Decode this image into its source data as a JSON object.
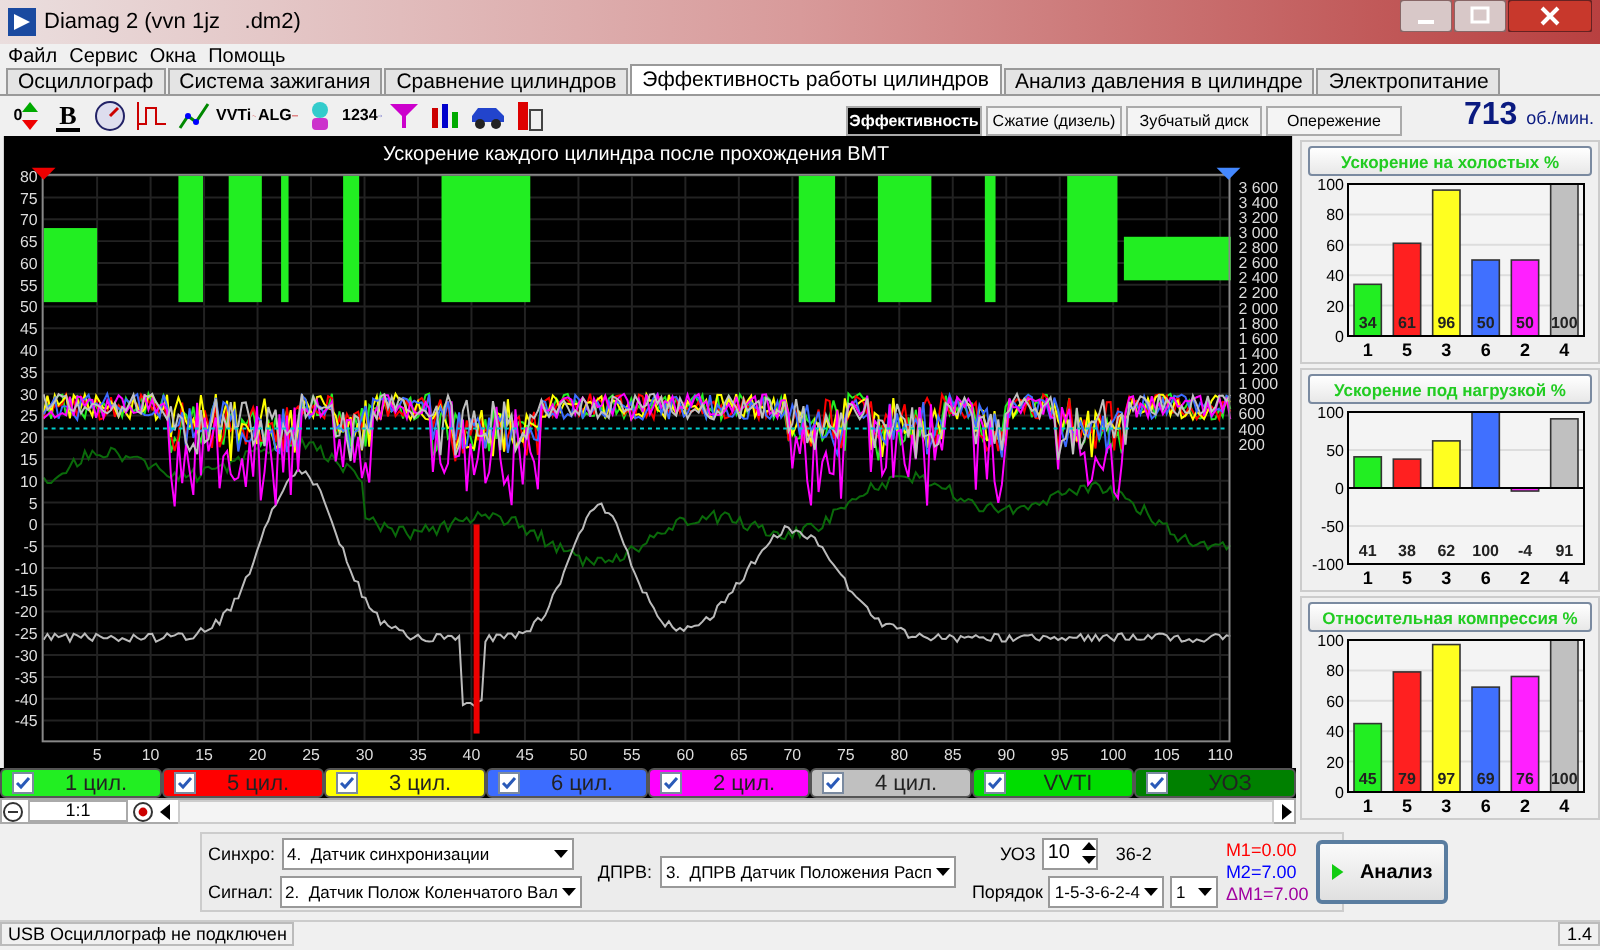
{
  "window": {
    "title": "Diamag 2 (vvn 1jz    .dm2)"
  },
  "menu": [
    "Файл",
    "Сервис",
    "Окна",
    "Помощь"
  ],
  "tabs": [
    {
      "label": "Осциллограф",
      "selected": false
    },
    {
      "label": "Система зажигания",
      "selected": false
    },
    {
      "label": "Сравнение цилиндров",
      "selected": false
    },
    {
      "label": "Эффективность работы цилиндров",
      "selected": true
    },
    {
      "label": "Анализ давления в цилиндре",
      "selected": false
    },
    {
      "label": "Электропитание",
      "selected": false
    }
  ],
  "toolbar": [
    {
      "kind": "zero",
      "label": "0"
    },
    {
      "kind": "bold",
      "label": "B"
    },
    {
      "kind": "gauge"
    },
    {
      "kind": "step"
    },
    {
      "kind": "graph"
    },
    {
      "kind": "vvti",
      "label": "VVTi"
    },
    {
      "kind": "alg",
      "label": "ALG"
    },
    {
      "kind": "figure"
    },
    {
      "kind": "sequence",
      "label": "1234"
    },
    {
      "kind": "funnel"
    },
    {
      "kind": "bars"
    },
    {
      "kind": "car"
    },
    {
      "kind": "meter"
    }
  ],
  "sub_tabs": [
    {
      "label": "Эффективность",
      "selected": true
    },
    {
      "label": "Сжатие (дизель)",
      "selected": false
    },
    {
      "label": "Зубчатый диск",
      "selected": false
    },
    {
      "label": "Опережение",
      "selected": false
    }
  ],
  "rpm": {
    "value": "713",
    "unit": "об./мин."
  },
  "main_chart": {
    "title": "Ускорение каждого цилиндра после прохождения ВМТ",
    "left_ticks": [
      "80",
      "75",
      "70",
      "65",
      "60",
      "55",
      "50",
      "45",
      "40",
      "35",
      "30",
      "25",
      "20",
      "15",
      "10",
      "5",
      "0",
      "-5",
      "-10",
      "-15",
      "-20",
      "-25",
      "-30",
      "-35",
      "-40",
      "-45"
    ],
    "right_ticks": [
      "3 600",
      "3 400",
      "3 200",
      "3 000",
      "2 800",
      "2 600",
      "2 400",
      "2 200",
      "2 000",
      "1 800",
      "1 600",
      "1 400",
      "1 200",
      "1 000",
      "800",
      "600",
      "400",
      "200"
    ],
    "x_ticks": [
      "5",
      "10",
      "15",
      "20",
      "25",
      "30",
      "35",
      "40",
      "45",
      "50",
      "55",
      "60",
      "65",
      "70",
      "75",
      "80",
      "85",
      "90",
      "95",
      "100",
      "105",
      "110"
    ]
  },
  "legend": [
    {
      "label": "1 цил.",
      "color": "#22ee22",
      "checked": true
    },
    {
      "label": "5 цил.",
      "color": "#ff0000",
      "checked": true
    },
    {
      "label": "3 цил.",
      "color": "#ffff00",
      "checked": true
    },
    {
      "label": "6 цил.",
      "color": "#3c6cff",
      "checked": true
    },
    {
      "label": "2 цил.",
      "color": "#ff00ff",
      "checked": true
    },
    {
      "label": "4 цил.",
      "color": "#c0c0c0",
      "checked": true
    },
    {
      "label": "VVTI",
      "color": "#00dd00",
      "checked": true
    },
    {
      "label": "УОЗ",
      "color": "#008000",
      "checked": true
    }
  ],
  "zoom": {
    "ratio": "1:1"
  },
  "charts": [
    {
      "chart_data": {
        "type": "bar",
        "title": "Ускорение на холостых %",
        "categories": [
          "1",
          "5",
          "3",
          "6",
          "2",
          "4"
        ],
        "values": [
          34,
          61,
          96,
          50,
          50,
          100
        ],
        "colors": [
          "#22ee22",
          "#ff2020",
          "#ffff20",
          "#4070ff",
          "#ff20ff",
          "#c0c0c0"
        ],
        "ylim": [
          0,
          100
        ],
        "yticks": [
          0,
          20,
          40,
          60,
          80,
          100
        ],
        "data_labels": true,
        "grid": true
      }
    },
    {
      "chart_data": {
        "type": "bar",
        "title": "Ускорение под нагрузкой %",
        "categories": [
          "1",
          "5",
          "3",
          "6",
          "2",
          "4"
        ],
        "values": [
          41,
          38,
          62,
          100,
          -4,
          91
        ],
        "colors": [
          "#22ee22",
          "#ff2020",
          "#ffff20",
          "#4070ff",
          "#ff20ff",
          "#c0c0c0"
        ],
        "ylim": [
          -100,
          100
        ],
        "yticks": [
          -100,
          -50,
          0,
          50,
          100
        ],
        "grid": true
      },
      "footer_labels": [
        "41",
        "38",
        "62",
        "100",
        "-4",
        "91"
      ]
    },
    {
      "chart_data": {
        "type": "bar",
        "title": "Относительная компрессия %",
        "categories": [
          "1",
          "5",
          "3",
          "6",
          "2",
          "4"
        ],
        "values": [
          45,
          79,
          97,
          69,
          76,
          100
        ],
        "colors": [
          "#22ee22",
          "#ff2020",
          "#ffff20",
          "#4070ff",
          "#ff20ff",
          "#c0c0c0"
        ],
        "ylim": [
          0,
          100
        ],
        "yticks": [
          0,
          20,
          40,
          60,
          80,
          100
        ],
        "data_labels": true,
        "grid": true
      }
    }
  ],
  "controls": {
    "sync": {
      "label": "Синхро:",
      "value": "4.  Датчик синхронизации"
    },
    "signal": {
      "label": "Сигнал:",
      "value": "2.  Датчик Полож Коленчатого Вал"
    },
    "dprv": {
      "label": "ДПРВ:",
      "value": "3.  ДПРВ Датчик Положения Расп"
    },
    "uoz": {
      "label": "УОЗ",
      "value": "10"
    },
    "wheel": "36-2",
    "order": {
      "label": "Порядок",
      "value": "1-5-3-6-2-4",
      "cylinder": "1"
    },
    "markers": [
      {
        "text": "M1=0.00",
        "color": "#ff0000"
      },
      {
        "text": "M2=7.00",
        "color": "#0000ff"
      },
      {
        "text": "ΔM1=7.00",
        "color": "#a000a0"
      }
    ],
    "analyze_button": "Анализ"
  },
  "status_bar": {
    "message": "USB Осциллограф не подключен",
    "version": "1.4"
  }
}
